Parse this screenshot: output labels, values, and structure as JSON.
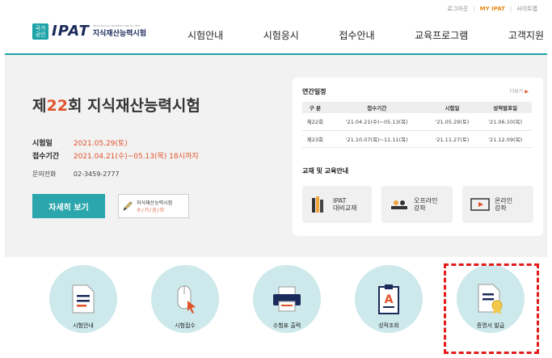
{
  "top_links": {
    "logout": "로그아웃",
    "my_ipat": "MY IPAT",
    "sitemap": "사이트맵"
  },
  "logo": {
    "badge": "국가\n공인",
    "brand": "IPAT",
    "tagline": "INTELLECTUAL PROPERTY ABILITY TEST",
    "name": "지식재산능력시험"
  },
  "nav": {
    "items": [
      "시험안내",
      "시험응시",
      "접수안내",
      "교육프로그램",
      "고객지원"
    ]
  },
  "hero": {
    "title_prefix": "제",
    "title_num": "22",
    "title_suffix": "회 지식재산능력시험",
    "exam_date_label": "시험일",
    "exam_date_value": "2021.05.29(토)",
    "period_label": "접수기간",
    "period_value": "2021.04.21(수)~05.13(목) 18시까지",
    "phone_label": "문의전화",
    "phone_value": "02-3459-2777",
    "detail_button": "자세히 보기",
    "slogan_line1": "지식재산능력시험",
    "slogan_line2": "수/기/공/모"
  },
  "schedule": {
    "title": "연간일정",
    "more": "더보기",
    "headers": [
      "구 분",
      "접수기간",
      "시험일",
      "성적발표일"
    ],
    "rows": [
      [
        "제22회",
        "'21.04.21(수)~05.13(목)",
        "'21.05.29(토)",
        "'21.06.10(목)"
      ],
      [
        "제23회",
        "'21.10.07(목)~11.11(목)",
        "'21.11.27(토)",
        "'21.12.09(목)"
      ]
    ]
  },
  "education": {
    "title": "교재 및 교육안내",
    "items": [
      {
        "line1": "IPAT",
        "line2": "대비교재",
        "icon": "books-icon"
      },
      {
        "line1": "오프라인",
        "line2": "강좌",
        "icon": "classroom-icon"
      },
      {
        "line1": "온라인",
        "line2": "강좌",
        "icon": "video-play-icon"
      }
    ]
  },
  "quick_menu": [
    {
      "label": "시험안내",
      "icon": "document-icon"
    },
    {
      "label": "시험접수",
      "icon": "mouse-icon"
    },
    {
      "label": "수험표 출력",
      "icon": "printer-icon"
    },
    {
      "label": "성적조회",
      "icon": "grade-clipboard-icon"
    },
    {
      "label": "증명서 발급",
      "icon": "certificate-icon"
    }
  ],
  "colors": {
    "accent": "#1ba3a8",
    "highlight": "#e0532b",
    "circle": "#cde9eb",
    "dashed_box": "#e31b1b"
  }
}
